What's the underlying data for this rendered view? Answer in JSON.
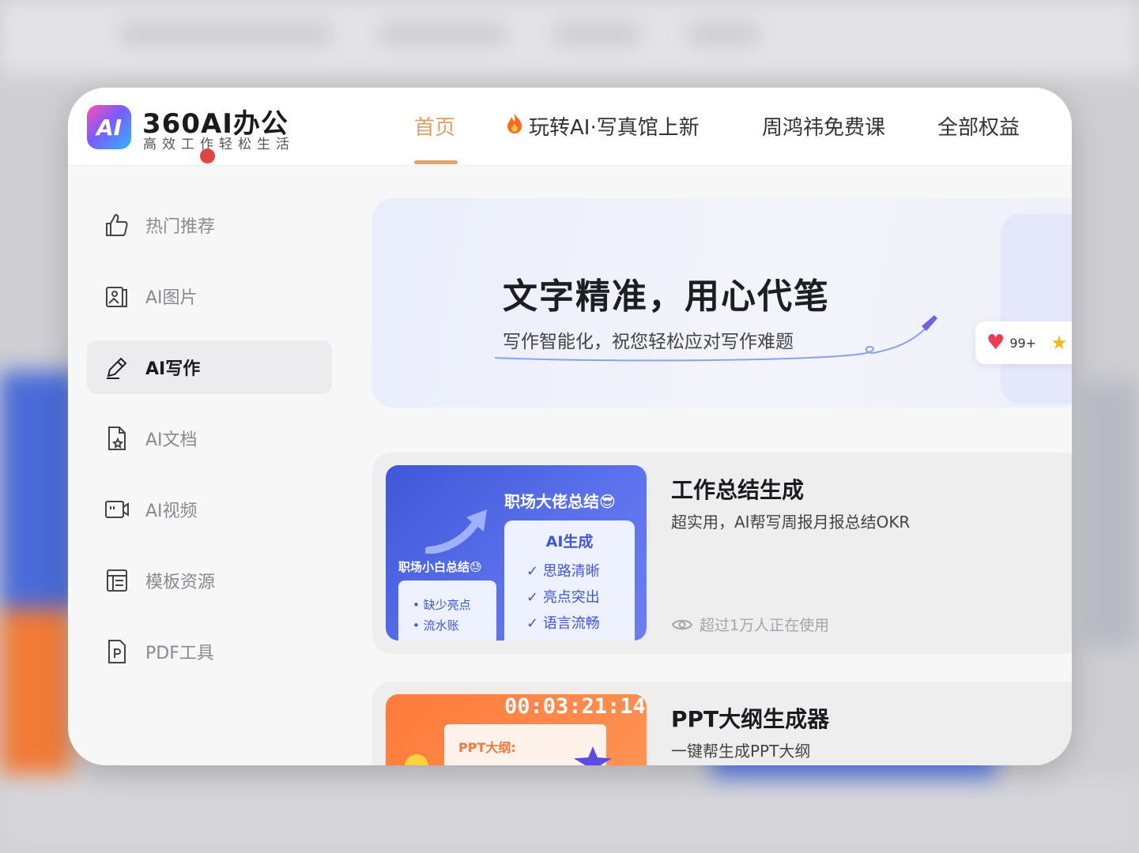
{
  "brand": {
    "logo_text": "AI",
    "name": "360AI办公",
    "slogan": "高效工作轻松生活"
  },
  "nav": {
    "items": [
      {
        "label": "首页",
        "active": true
      },
      {
        "label": "玩转AI·写真馆上新",
        "icon": "flame-icon"
      },
      {
        "label": "周鸿祎免费课"
      },
      {
        "label": "全部权益"
      }
    ]
  },
  "sidebar": {
    "items": [
      {
        "label": "热门推荐",
        "icon": "thumbs-up-icon"
      },
      {
        "label": "AI图片",
        "icon": "image-icon"
      },
      {
        "label": "AI写作",
        "icon": "pen-icon",
        "active": true
      },
      {
        "label": "AI文档",
        "icon": "document-icon"
      },
      {
        "label": "AI视频",
        "icon": "video-icon"
      },
      {
        "label": "模板资源",
        "icon": "template-icon"
      },
      {
        "label": "PDF工具",
        "icon": "pdf-icon"
      }
    ]
  },
  "banner": {
    "title": "文字精准，用心代笔",
    "subtitle": "写作智能化，祝您轻松应对写作难题"
  },
  "badge": {
    "count": "99+"
  },
  "tools": [
    {
      "title": "工作总结生成",
      "desc": "超实用，AI帮写周报月报总结OKR",
      "usage": "超过1万人正在使用",
      "thumb": {
        "head": "职场大佬总结😎",
        "panel_title": "AI生成",
        "checks": [
          "思路清晰",
          "亮点突出",
          "语言流畅"
        ],
        "left_head": "职场小白总结😓",
        "left_items": [
          "缺少亮点",
          "流水账"
        ]
      }
    },
    {
      "title": "PPT大纲生成器",
      "desc": "一键帮生成PPT大纲",
      "thumb": {
        "time": "00:03:21:14",
        "paper_title": "PPT大纲:"
      }
    }
  ],
  "colors": {
    "accent": "#d8a06a",
    "active_bg": "#ececef",
    "thumb_blue": "#3f57d8",
    "thumb_orange": "#ff7a3a"
  }
}
